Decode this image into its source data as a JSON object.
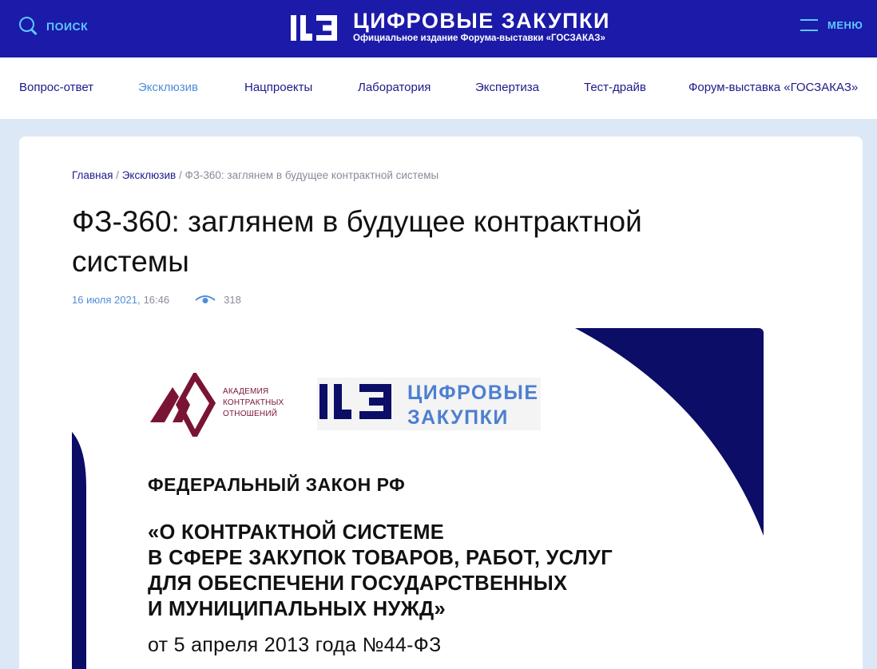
{
  "header": {
    "search_label": "ПОИСК",
    "brand_title": "ЦИФРОВЫЕ ЗАКУПКИ",
    "brand_subtitle": "Официальное издание Форума-выставки «ГОСЗАКАЗ»",
    "menu_label": "МЕНЮ"
  },
  "nav": {
    "items": [
      {
        "label": "Вопрос-ответ"
      },
      {
        "label": "Эксклюзив"
      },
      {
        "label": "Нацпроекты"
      },
      {
        "label": "Лаборатория"
      },
      {
        "label": "Экспертиза"
      },
      {
        "label": "Тест-драйв"
      },
      {
        "label": "Форум-выставка «ГОСЗАКАЗ»"
      }
    ]
  },
  "breadcrumb": {
    "home": "Главная",
    "section": "Эксклюзив",
    "current": "ФЗ-360: заглянем в будущее контрактной системы",
    "separator": "/"
  },
  "article": {
    "title": "ФЗ-360: заглянем в будущее контрактной системы",
    "date": "16 июля 2021,",
    "time": "16:46",
    "views": "318"
  },
  "hero": {
    "ako_line1": "АКАДЕМИЯ",
    "ako_line2": "КОНТРАКТНЫХ",
    "ako_line3": "ОТНОШЕНИЙ",
    "dz_line1": "ЦИФРОВЫЕ",
    "dz_line2": "ЗАКУПКИ",
    "law_heading": "ФЕДЕРАЛЬНЫЙ ЗАКОН РФ",
    "law_name": "«О КОНТРАКТНОЙ СИСТЕМЕ\nВ СФЕРЕ ЗАКУПОК ТОВАРОВ, РАБОТ, УСЛУГ\nДЛЯ ОБЕСПЕЧЕНИ ГОСУДАРСТВЕННЫХ\nИ МУНИЦИПАЛЬНЫХ НУЖД»",
    "law_date": "от 5 апреля 2013 года №44-ФЗ"
  },
  "colors": {
    "header_bg": "#1c1aa8",
    "accent_cyan": "#5ec8ff",
    "nav_text": "#1d1a8a",
    "nav_active": "#4f8ed8",
    "page_bg": "#dce8f6",
    "hero_navy": "#0b0d66",
    "ako_maroon": "#7a1433"
  }
}
